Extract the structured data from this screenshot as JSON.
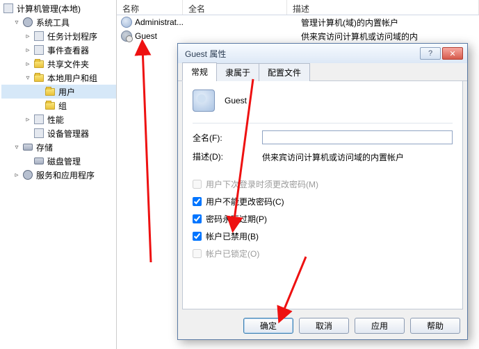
{
  "root_label": "计算机管理(本地)",
  "tree": {
    "items": [
      {
        "label": "系统工具",
        "twisty": "▿"
      },
      {
        "label": "任务计划程序",
        "twisty": "▹"
      },
      {
        "label": "事件查看器",
        "twisty": "▹"
      },
      {
        "label": "共享文件夹",
        "twisty": "▹"
      },
      {
        "label": "本地用户和组",
        "twisty": "▿"
      },
      {
        "label": "用户"
      },
      {
        "label": "组"
      },
      {
        "label": "性能",
        "twisty": "▹"
      },
      {
        "label": "设备管理器"
      },
      {
        "label": "存储",
        "twisty": "▿"
      },
      {
        "label": "磁盘管理"
      },
      {
        "label": "服务和应用程序",
        "twisty": "▹"
      }
    ]
  },
  "list": {
    "columns": {
      "name": "名称",
      "fullname": "全名",
      "desc": "描述"
    },
    "rows": [
      {
        "name": "Administrat...",
        "fullname": "",
        "desc": "管理计算机(域)的内置帐户"
      },
      {
        "name": "Guest",
        "fullname": "",
        "desc": "供来宾访问计算机或访问域的内"
      }
    ]
  },
  "dialog": {
    "title": "Guest 属性",
    "tabs": [
      "常规",
      "隶属于",
      "配置文件"
    ],
    "username": "Guest",
    "fullname_label": "全名(F):",
    "fullname_value": "",
    "desc_label": "描述(D):",
    "desc_value": "供来宾访问计算机或访问域的内置帐户",
    "chk1": "用户下次登录时须更改密码(M)",
    "chk2": "用户不能更改密码(C)",
    "chk3": "密码永不过期(P)",
    "chk4": "帐户已禁用(B)",
    "chk5": "帐户已锁定(O)",
    "buttons": {
      "ok": "确定",
      "cancel": "取消",
      "apply": "应用",
      "help": "帮助"
    }
  }
}
